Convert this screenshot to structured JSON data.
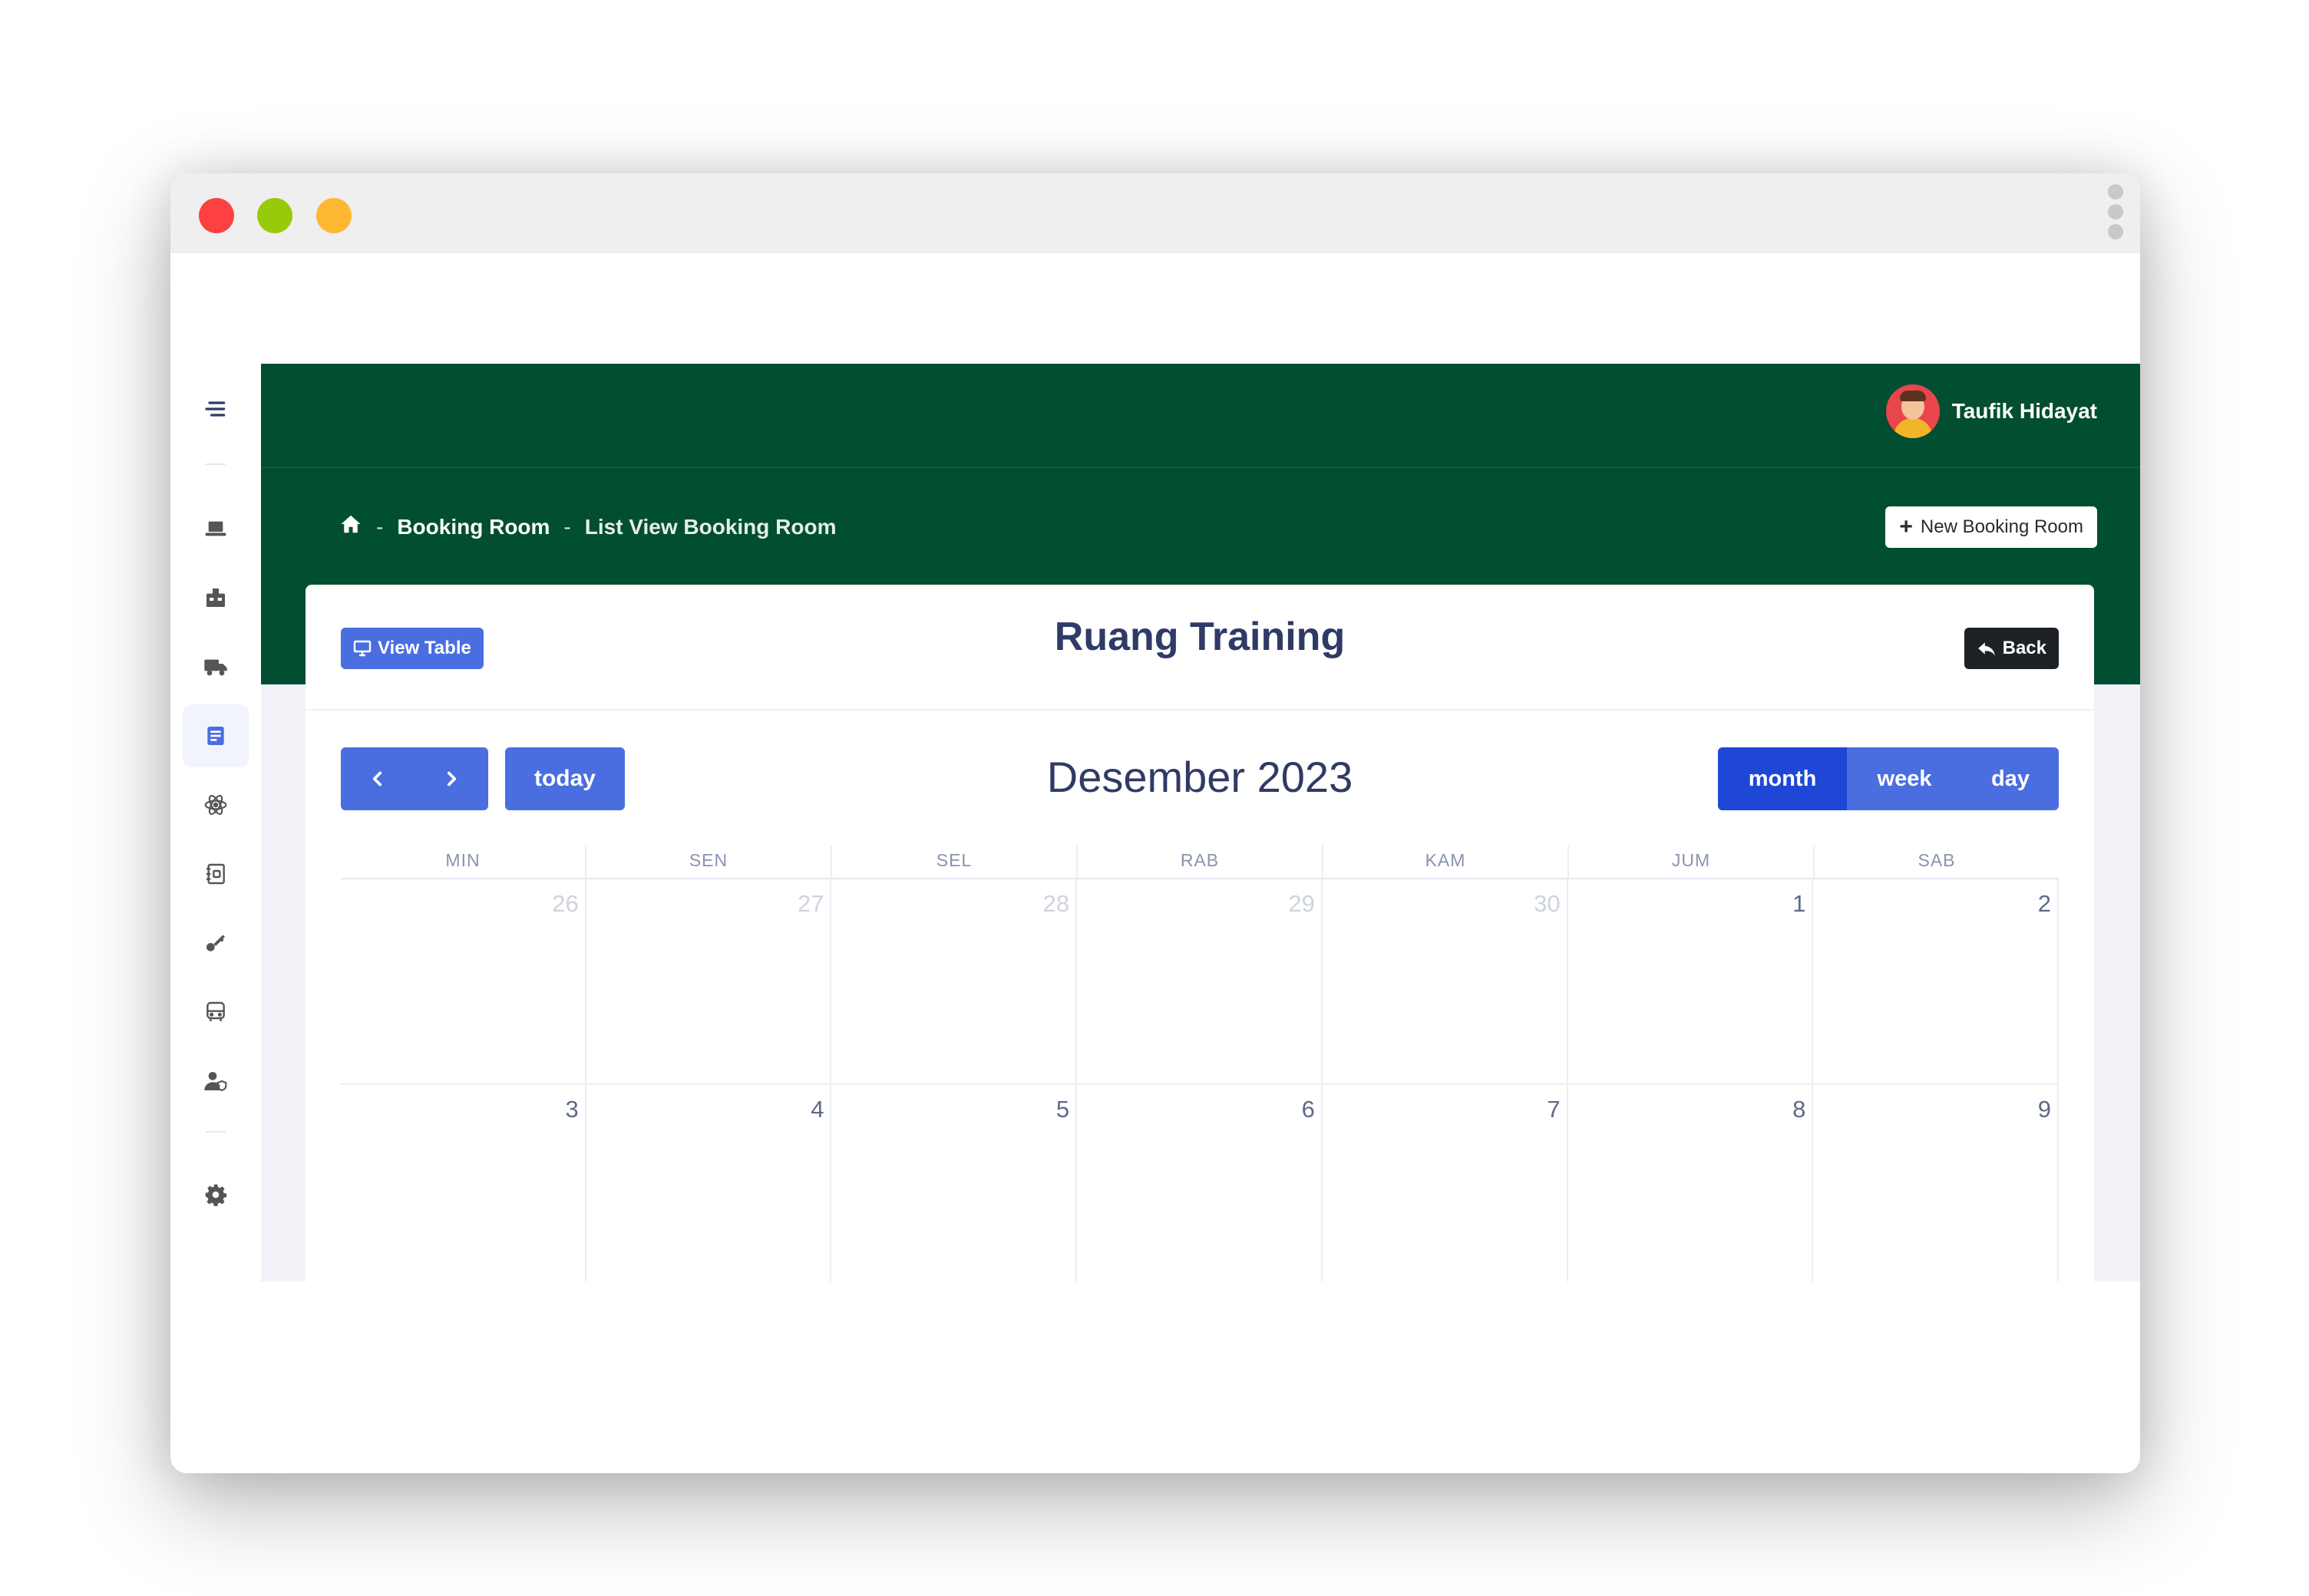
{
  "window": {
    "controls": [
      "close",
      "minimize",
      "maximize"
    ],
    "colors": {
      "close": "#fd4041",
      "minimize": "#97cb09",
      "maximize": "#fdb733"
    }
  },
  "sidebar": {
    "items": [
      {
        "icon": "menu-icon",
        "active": false
      },
      {
        "icon": "laptop-icon",
        "active": false
      },
      {
        "icon": "dashboard-icon",
        "active": false
      },
      {
        "icon": "truck-icon",
        "active": false
      },
      {
        "icon": "document-list-icon",
        "active": true
      },
      {
        "icon": "atom-icon",
        "active": false
      },
      {
        "icon": "contact-book-icon",
        "active": false
      },
      {
        "icon": "key-icon",
        "active": false
      },
      {
        "icon": "bus-icon",
        "active": false
      },
      {
        "icon": "user-shield-icon",
        "active": false
      },
      {
        "icon": "gear-icon",
        "active": false
      }
    ]
  },
  "header": {
    "user_name": "Taufik Hidayat",
    "bg_color": "#024e31"
  },
  "breadcrumb": {
    "items": [
      "Booking Room",
      "List View Booking Room"
    ],
    "separator": "-"
  },
  "actions": {
    "new_booking": "New Booking Room"
  },
  "card": {
    "title": "Ruang Training",
    "view_table": "View Table",
    "back": "Back"
  },
  "calendar": {
    "title": "Desember 2023",
    "today": "today",
    "views": [
      "month",
      "week",
      "day"
    ],
    "active_view": "month",
    "days_of_week": [
      "MIN",
      "SEN",
      "SEL",
      "RAB",
      "KAM",
      "JUM",
      "SAB"
    ],
    "weeks": [
      [
        {
          "d": "26",
          "other": true
        },
        {
          "d": "27",
          "other": true
        },
        {
          "d": "28",
          "other": true
        },
        {
          "d": "29",
          "other": true
        },
        {
          "d": "30",
          "other": true
        },
        {
          "d": "1",
          "other": false
        },
        {
          "d": "2",
          "other": false
        }
      ],
      [
        {
          "d": "3",
          "other": false
        },
        {
          "d": "4",
          "other": false
        },
        {
          "d": "5",
          "other": false
        },
        {
          "d": "6",
          "other": false
        },
        {
          "d": "7",
          "other": false
        },
        {
          "d": "8",
          "other": false
        },
        {
          "d": "9",
          "other": false
        }
      ]
    ],
    "accent_color": "#4a6ee0",
    "active_view_color": "#1f47d6"
  }
}
